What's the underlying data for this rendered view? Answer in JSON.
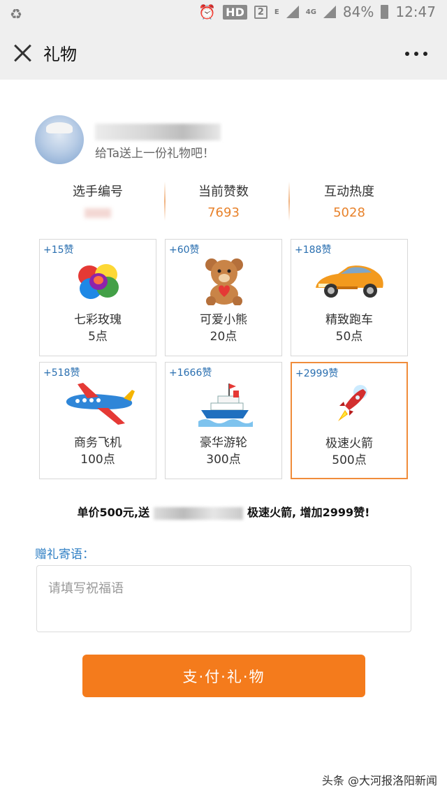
{
  "status_bar": {
    "hd": "HD",
    "sim": "2",
    "network_small": "E",
    "network_4g": "4G",
    "battery": "84%",
    "time": "12:47"
  },
  "nav": {
    "title": "礼物"
  },
  "profile": {
    "subtitle": "给Ta送上一份礼物吧！"
  },
  "stats": [
    {
      "label": "选手编号",
      "value": ""
    },
    {
      "label": "当前赞数",
      "value": "7693"
    },
    {
      "label": "互动热度",
      "value": "5028"
    }
  ],
  "gifts": [
    {
      "badge": "+15赞",
      "name": "七彩玫瑰",
      "price": "5点",
      "icon": "rainbow-rose-icon"
    },
    {
      "badge": "+60赞",
      "name": "可爱小熊",
      "price": "20点",
      "icon": "teddy-bear-icon"
    },
    {
      "badge": "+188赞",
      "name": "精致跑车",
      "price": "50点",
      "icon": "sports-car-icon"
    },
    {
      "badge": "+518赞",
      "name": "商务飞机",
      "price": "100点",
      "icon": "airplane-icon"
    },
    {
      "badge": "+1666赞",
      "name": "豪华游轮",
      "price": "300点",
      "icon": "cruise-ship-icon"
    },
    {
      "badge": "+2999赞",
      "name": "极速火箭",
      "price": "500点",
      "icon": "rocket-icon",
      "selected": true
    }
  ],
  "summary": {
    "prefix": "单价500元,送",
    "suffix": "极速火箭, 增加2999赞!"
  },
  "message": {
    "label": "赠礼寄语：",
    "placeholder": "请填写祝福语"
  },
  "pay_button": "支·付·礼·物",
  "watermark": "头条 @大河报洛阳新闻",
  "colors": {
    "accent": "#f47b1c",
    "stat_value": "#e8822b",
    "badge": "#2a6fb0",
    "label_blue": "#2f7fc4"
  }
}
